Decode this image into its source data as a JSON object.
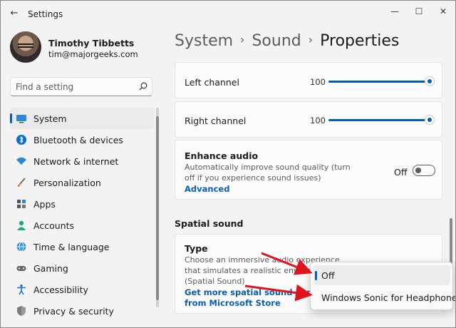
{
  "window": {
    "title": "Settings",
    "back_glyph": "←",
    "minimize_glyph": "—",
    "maximize_glyph": "☐",
    "close_glyph": "✕"
  },
  "profile": {
    "name": "Timothy Tibbetts",
    "email": "tim@majorgeeks.com"
  },
  "search": {
    "placeholder": "Find a setting",
    "icon": "search-icon"
  },
  "nav": {
    "items": [
      {
        "label": "System",
        "icon": "system-icon",
        "active": true
      },
      {
        "label": "Bluetooth & devices",
        "icon": "bluetooth-icon"
      },
      {
        "label": "Network & internet",
        "icon": "wifi-icon"
      },
      {
        "label": "Personalization",
        "icon": "brush-icon"
      },
      {
        "label": "Apps",
        "icon": "apps-icon"
      },
      {
        "label": "Accounts",
        "icon": "person-icon"
      },
      {
        "label": "Time & language",
        "icon": "globe-icon"
      },
      {
        "label": "Gaming",
        "icon": "gamepad-icon"
      },
      {
        "label": "Accessibility",
        "icon": "accessibility-icon"
      },
      {
        "label": "Privacy & security",
        "icon": "shield-icon"
      }
    ]
  },
  "breadcrumb": {
    "parts": [
      "System",
      "Sound"
    ],
    "current": "Properties",
    "separator": "›"
  },
  "channels": {
    "left": {
      "label": "Left channel",
      "value": "100",
      "level": 100
    },
    "right": {
      "label": "Right channel",
      "value": "100",
      "level": 100
    }
  },
  "enhance": {
    "title": "Enhance audio",
    "description": "Automatically improve sound quality (turn off if you experience sound issues)",
    "link": "Advanced",
    "toggle_state": "Off"
  },
  "spatial": {
    "section_title": "Spatial sound",
    "type_title": "Type",
    "type_description": "Choose an immersive audio experience that simulates a realistic environment (Spatial Sound)",
    "link": "Get more spatial sound apps from Microsoft Store",
    "options": [
      {
        "label": "Off",
        "selected": true
      },
      {
        "label": "Windows Sonic for Headphones",
        "selected": false
      }
    ]
  },
  "colors": {
    "accent": "#005fb8",
    "link": "#0a5fb4",
    "annotation_arrow": "#e0141e"
  }
}
